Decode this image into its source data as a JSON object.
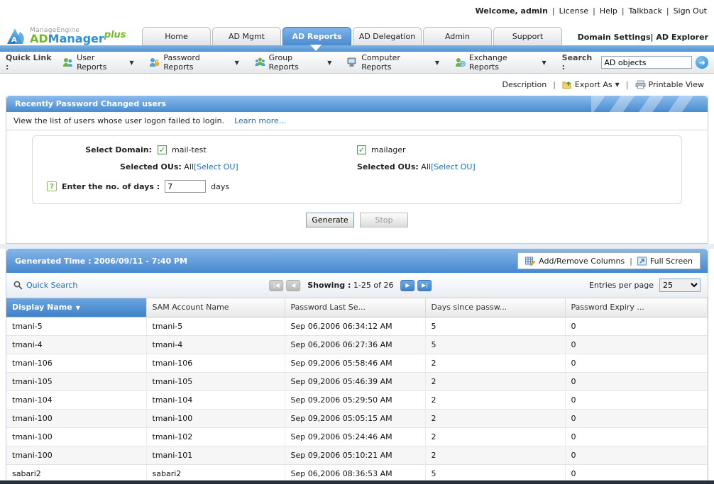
{
  "topbar": {
    "welcome": "Welcome, admin",
    "links": [
      "License",
      "Help",
      "Talkback",
      "Sign Out"
    ]
  },
  "logo": {
    "brand": "ManageEngine",
    "ad": "AD",
    "manager": "Manager",
    "plus": "plus",
    "emblem": "AD"
  },
  "nav": {
    "tabs": [
      {
        "label": "Home"
      },
      {
        "label": "AD Mgmt"
      },
      {
        "label": "AD Reports"
      },
      {
        "label": "AD Delegation"
      },
      {
        "label": "Admin"
      },
      {
        "label": "Support"
      }
    ],
    "active_tab": "AD Reports",
    "domain_settings": "Domain Settings",
    "pipe": "|",
    "ad_explorer": "AD Explorer"
  },
  "quicklink": {
    "label": "Quick Link :",
    "items": [
      "User Reports",
      "Password Reports",
      "Group Reports",
      "Computer Reports",
      "Exchange Reports"
    ],
    "search_label": "Search :",
    "search_value": "AD objects"
  },
  "toolbar": {
    "description": "Description",
    "export_as": "Export As",
    "printable_view": "Printable View"
  },
  "report": {
    "title": "Recently Password Changed users",
    "subtitle": "View the list of users whose user logon failed to login.",
    "learn_more": "Learn more...",
    "form": {
      "select_domain_label": "Select Domain:",
      "domains": [
        {
          "name": "mail-test",
          "checked": true,
          "ous_label": "Selected OUs:",
          "ous_value": "All",
          "ou_link": "[Select OU]"
        },
        {
          "name": "mailager",
          "checked": true,
          "ous_label": "Selected OUs:",
          "ous_value": "All",
          "ou_link": "[Select OU]"
        }
      ],
      "days_label": "Enter the no. of days :",
      "days_value": "7",
      "days_suffix": "days",
      "generate_label": "Generate",
      "stop_label": "Stop",
      "help_glyph": "?"
    }
  },
  "results": {
    "generated_time": "Generated Time : 2006/09/11 - 7:40 PM",
    "add_remove_columns": "Add/Remove Columns",
    "pipe": "|",
    "full_screen": "Full Screen",
    "quick_search": "Quick Search",
    "showing_label": "Showing :",
    "showing_value": "1-25 of 26",
    "entries_label": "Entries per page",
    "entries_value": "25",
    "columns": [
      "Display Name",
      "SAM Account Name",
      "Password Last Se...",
      "Days since passw...",
      "Password Expiry ..."
    ],
    "rows": [
      [
        "tmani-5",
        "tmani-5",
        "Sep 06,2006 06:34:12 AM",
        "5",
        "0"
      ],
      [
        "tmani-4",
        "tmani-4",
        "Sep 06,2006 06:27:36 AM",
        "5",
        "0"
      ],
      [
        "tmani-106",
        "tmani-106",
        "Sep 09,2006 05:58:46 AM",
        "2",
        "0"
      ],
      [
        "tmani-105",
        "tmani-105",
        "Sep 09,2006 05:46:39 AM",
        "2",
        "0"
      ],
      [
        "tmani-104",
        "tmani-104",
        "Sep 09,2006 05:29:50 AM",
        "2",
        "0"
      ],
      [
        "tmani-100",
        "tmani-100",
        "Sep 09,2006 05:05:15 AM",
        "2",
        "0"
      ],
      [
        "tmani-100",
        "tmani-102",
        "Sep 09,2006 05:24:46 AM",
        "2",
        "0"
      ],
      [
        "tmani-100",
        "tmani-101",
        "Sep 09,2006 05:10:21 AM",
        "2",
        "0"
      ],
      [
        "sabari2",
        "sabari2",
        "Sep 06,2006 08:36:53 AM",
        "5",
        "0"
      ]
    ]
  },
  "colors": {
    "accent_blue": "#4a8bd0",
    "link_blue": "#1a6fc4",
    "brand_green": "#76b82a",
    "brand_blue": "#2f8fd5"
  }
}
